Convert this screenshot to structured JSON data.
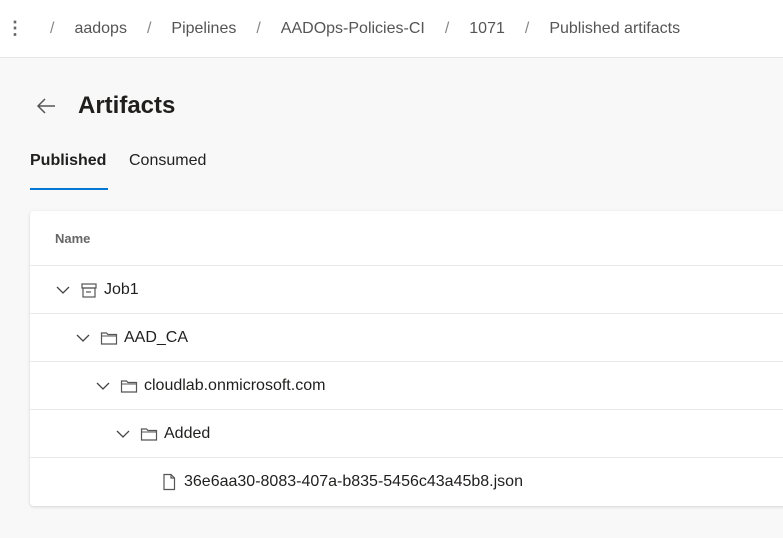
{
  "breadcrumb": [
    "aadops",
    "Pipelines",
    "AADOps-Policies-CI",
    "1071",
    "Published artifacts"
  ],
  "page": {
    "title": "Artifacts"
  },
  "tabs": [
    {
      "label": "Published",
      "active": true
    },
    {
      "label": "Consumed",
      "active": false
    }
  ],
  "table": {
    "column_header": "Name",
    "rows": [
      {
        "name": "Job1",
        "level": 0,
        "icon": "artifact-icon",
        "expanded": true
      },
      {
        "name": "AAD_CA",
        "level": 1,
        "icon": "folder-icon",
        "expanded": true
      },
      {
        "name": "cloudlab.onmicrosoft.com",
        "level": 2,
        "icon": "folder-icon",
        "expanded": true
      },
      {
        "name": "Added",
        "level": 3,
        "icon": "folder-icon",
        "expanded": true
      },
      {
        "name": "36e6aa30-8083-407a-b835-5456c43a45b8.json",
        "level": 4,
        "icon": "file-icon"
      }
    ]
  },
  "colors": {
    "accent": "#0078d4"
  }
}
